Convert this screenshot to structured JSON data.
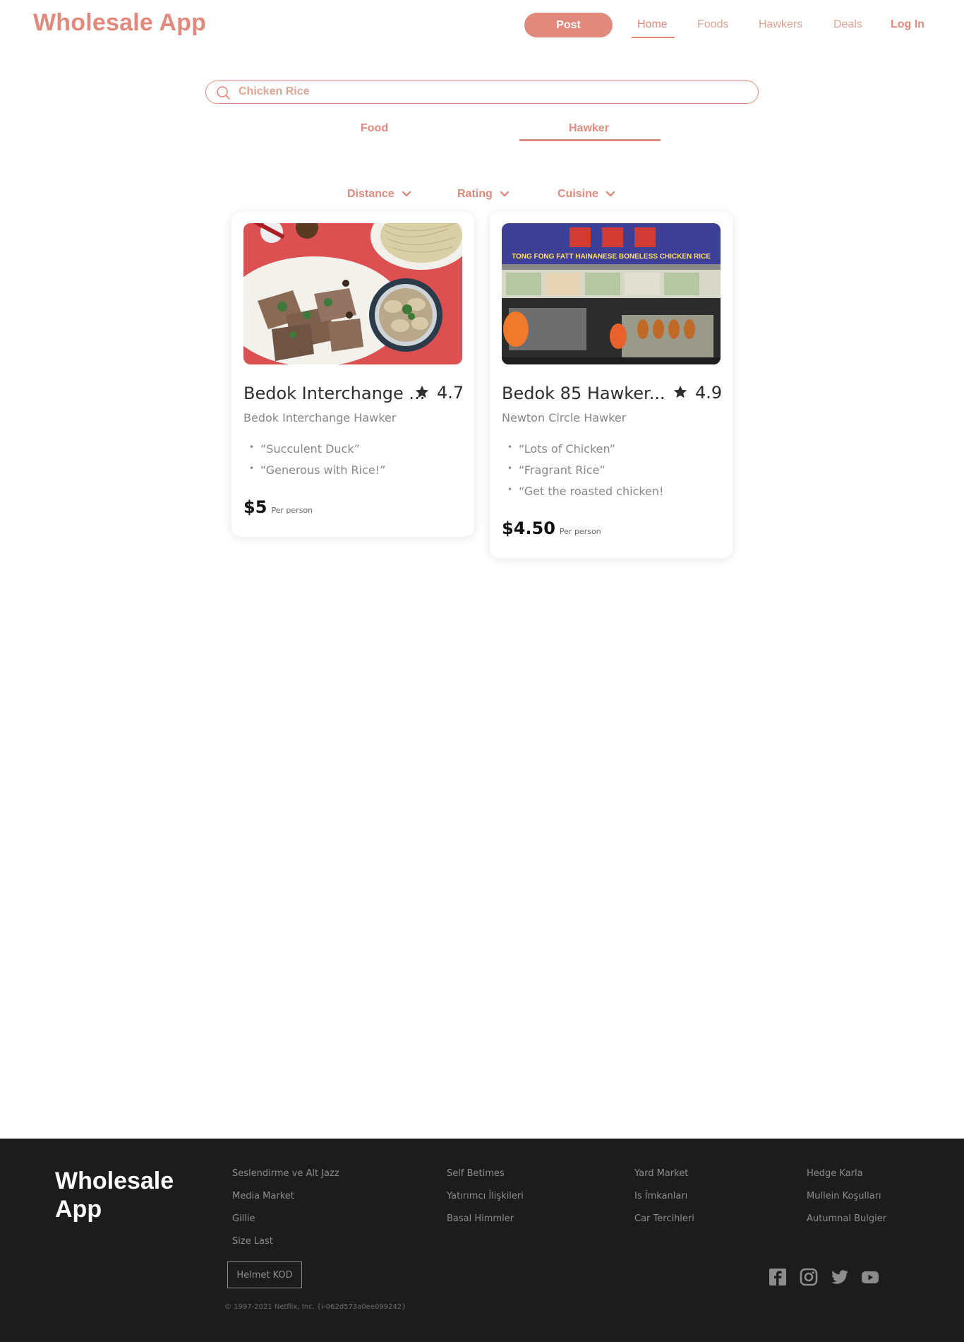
{
  "header": {
    "brand": "Wholesale App",
    "post_label": "Post",
    "nav": {
      "home": "Home",
      "foods": "Foods",
      "hawkers": "Hawkers",
      "deals": "Deals",
      "login": "Log In"
    },
    "active_nav": "Home"
  },
  "search": {
    "value": "Chicken Rice",
    "icon": "search-icon"
  },
  "tabs": {
    "food": "Food",
    "hawker": "Hawker",
    "active": "Hawker"
  },
  "filters": {
    "distance": "Distance",
    "rating": "Rating",
    "cuisine": "Cuisine"
  },
  "cards": [
    {
      "title": "Bedok Interchange ...",
      "rating": "4.7",
      "subtitle": "Bedok Interchange Hawker",
      "reviews": [
        "“Succulent Duck”",
        "“Generous with Rice!”"
      ],
      "price": "$5",
      "price_unit": "Per person"
    },
    {
      "title": "Bedok 85 Hawker...",
      "rating": "4.9",
      "subtitle": "Newton Circle Hawker",
      "reviews": [
        "“Lots of Chicken”",
        "“Fragrant Rice”",
        "“Get the roasted chicken!"
      ],
      "price": "$4.50",
      "price_unit": "Per person",
      "stall_sign_text": "TONG FONG FATT HAINANESE BONELESS CHICKEN RICE"
    }
  ],
  "footer": {
    "brand": "Wholesale App",
    "col1": [
      "Seslendirme ve Alt Jazz",
      "Media Market",
      "Gillie",
      "Size Last"
    ],
    "col2": [
      "Self Betimes",
      "Yatırımcı İlişkileri",
      "Basal Himmler"
    ],
    "col3": [
      "Yard Market",
      "Is İmkanları",
      "Car Tercihleri"
    ],
    "col4": [
      "Hedge Karla",
      "Mullein Koşulları",
      "Autumnal Bulgier"
    ],
    "service_button": "Helmet KOD",
    "copyright": "© 1997-2021 Netflix, Inc.  {i-062d573a0ee099242}"
  },
  "colors": {
    "accent": "#e0897c",
    "footer_bg": "#1c1c1c"
  }
}
